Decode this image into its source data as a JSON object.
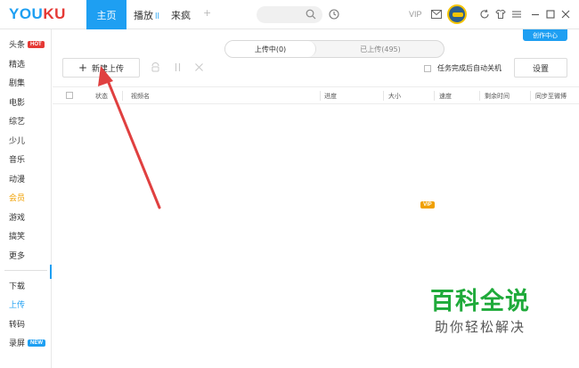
{
  "app": {
    "logo_part1": "YOU",
    "logo_part2": "KU"
  },
  "topbar": {
    "tabs": [
      {
        "label": "主页"
      },
      {
        "label": "播放"
      },
      {
        "label": "来疯"
      }
    ],
    "play_indicator": "ll",
    "add_tab": "+",
    "vip_label": "VIP"
  },
  "sidebar": {
    "items": [
      {
        "label": "头条",
        "badge": "HOT"
      },
      {
        "label": "精选"
      },
      {
        "label": "剧集"
      },
      {
        "label": "电影"
      },
      {
        "label": "综艺"
      },
      {
        "label": "少儿"
      },
      {
        "label": "音乐"
      },
      {
        "label": "动漫"
      },
      {
        "label": "会员",
        "badge": "VIP"
      },
      {
        "label": "游戏"
      },
      {
        "label": "搞笑"
      },
      {
        "label": "更多"
      }
    ],
    "bottom_items": [
      {
        "label": "下载"
      },
      {
        "label": "上传"
      },
      {
        "label": "转码"
      },
      {
        "label": "录屏",
        "badge": "NEW"
      }
    ]
  },
  "main": {
    "creator_center": "创作中心",
    "segment": {
      "uploading": "上传中(0)",
      "uploaded": "已上传(495)"
    },
    "new_upload_label": "新建上传",
    "new_upload_plus": "+",
    "auto_shutdown_label": "任务完成后自动关机",
    "settings_label": "设置",
    "columns": [
      "状态",
      "视频名",
      "进度",
      "大小",
      "速度",
      "剩余时间",
      "同步至微博"
    ]
  },
  "watermark": {
    "main": "百科全说",
    "sub": "助你轻松解决"
  },
  "colors": {
    "accent": "#1e9ff2",
    "hot": "#e53935",
    "vip": "#f0a000",
    "arrow": "#e04040",
    "watermark": "#1faa3a"
  },
  "icons": [
    "search-icon",
    "clock-icon",
    "mail-icon",
    "refresh-icon",
    "skin-icon",
    "menu-icon",
    "minimize-icon",
    "maximize-icon",
    "close-icon",
    "start-icon",
    "pause-icon",
    "delete-icon"
  ]
}
